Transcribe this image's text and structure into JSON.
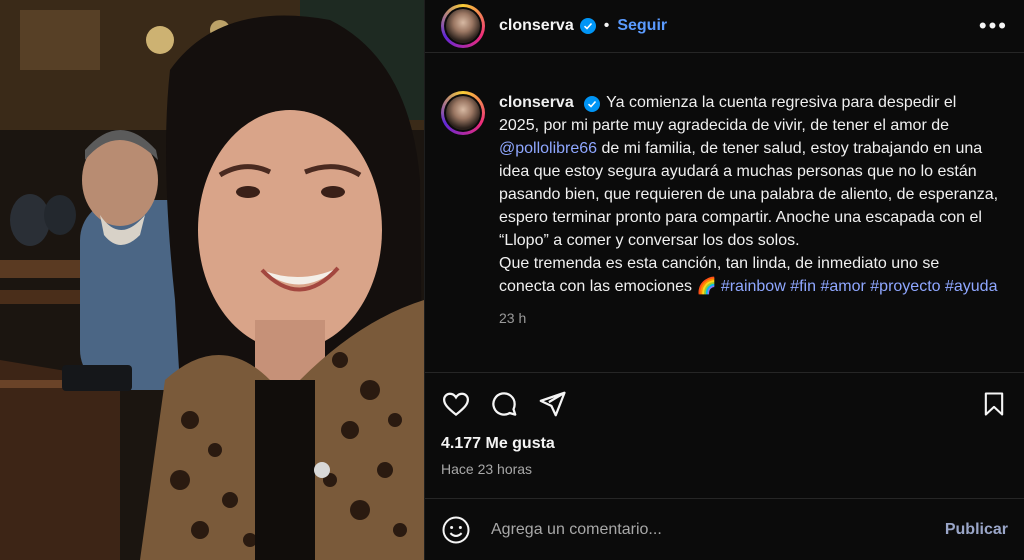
{
  "post": {
    "username": "clonserva",
    "follow_label": "Seguir",
    "more_label": "•••",
    "separator": "•"
  },
  "caption": {
    "username": "clonserva",
    "text_before_mention": "Ya comienza la cuenta regresiva para despedir el 2025, por mi parte muy agradecida de vivir, de tener el amor de ",
    "mention": "@pollolibre66",
    "text_after_mention": " de mi familia, de tener salud, estoy trabajando en una idea que estoy segura ayudará a muchas personas que no lo están pasando bien, que requieren de una palabra de aliento, de esperanza, espero terminar pronto para compartir. Anoche una escapada con el “Llopo” a comer y conversar los dos solos.",
    "line2": "Que tremenda es esta canción, tan linda, de inmediato uno se conecta con las emociones 🌈 ",
    "hashtags": [
      "#rainbow",
      "#fin",
      "#amor",
      "#proyecto",
      "#ayuda"
    ],
    "time": "23 h"
  },
  "stats": {
    "likes": "4.177 Me gusta",
    "posted": "Hace 23 horas"
  },
  "comment": {
    "placeholder": "Agrega un comentario...",
    "publish_label": "Publicar"
  },
  "icons": {
    "like": "heart-icon",
    "comment": "comment-bubble-icon",
    "share": "paper-plane-icon",
    "save": "bookmark-icon",
    "emoji": "smiley-icon",
    "verified": "verified-badge-icon"
  },
  "colors": {
    "accent_link": "#5b9bff",
    "hashtag": "#8fa7ff",
    "verified": "#0095f6",
    "background": "#0b0b0b"
  }
}
